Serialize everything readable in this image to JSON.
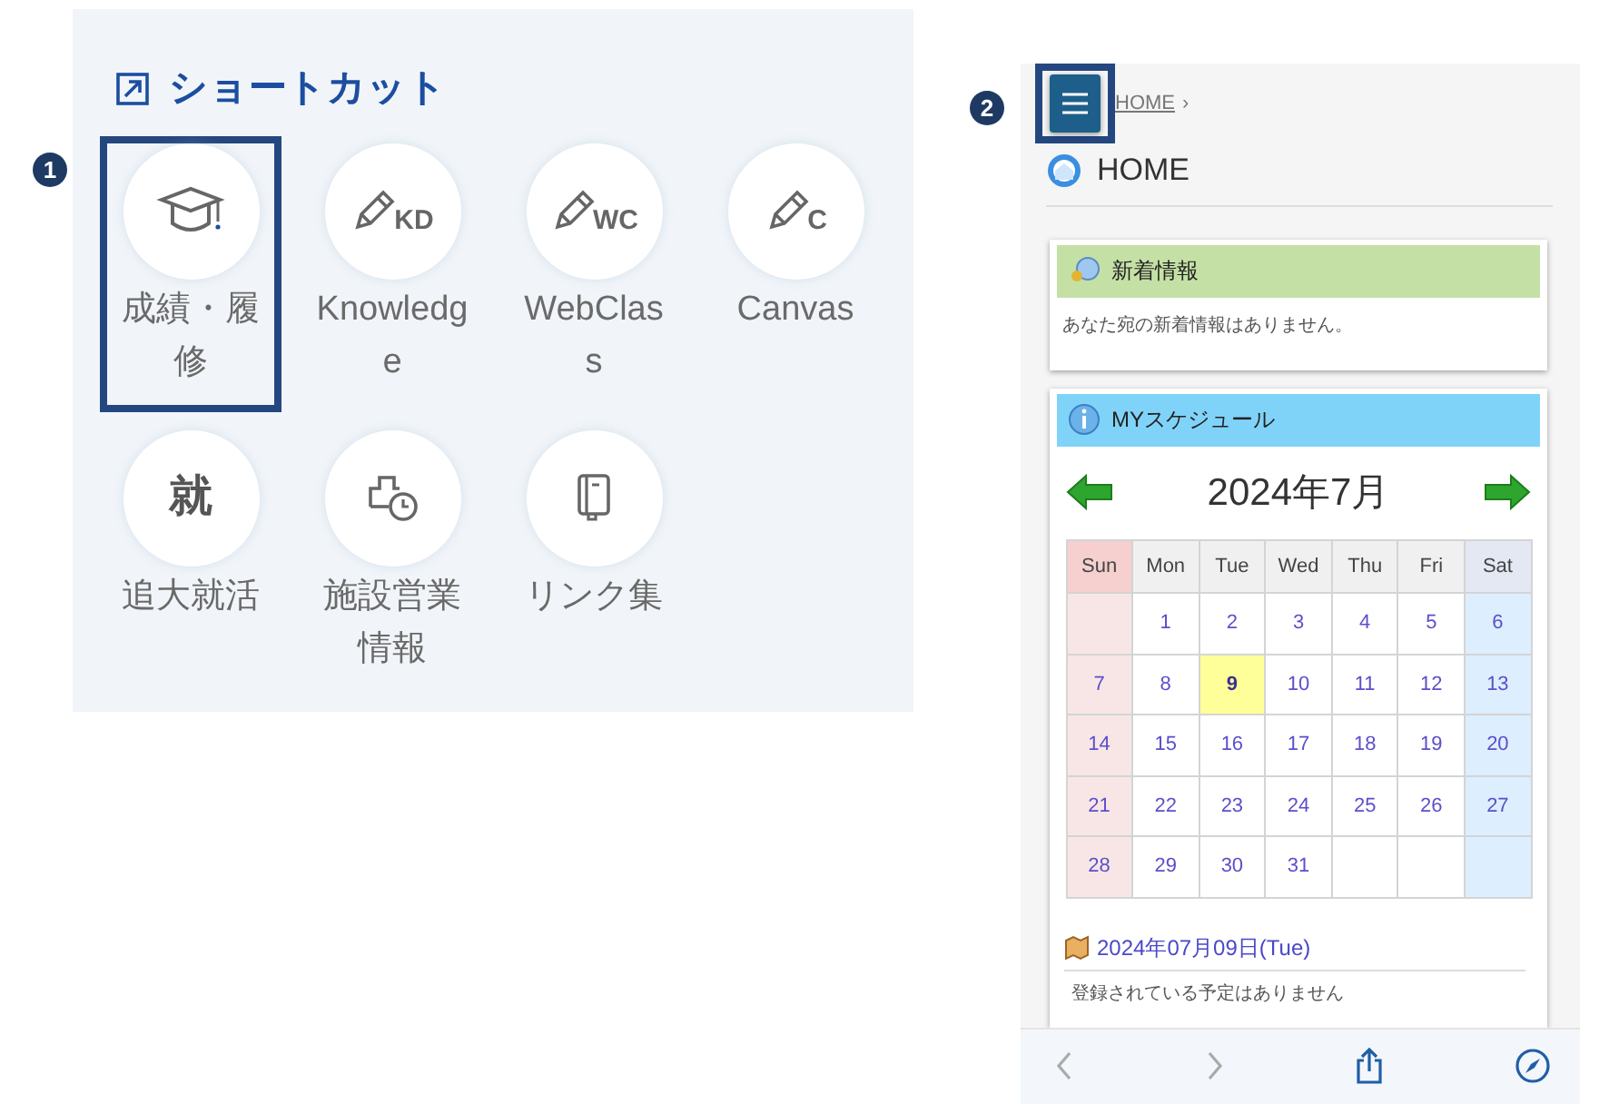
{
  "callouts": [
    {
      "label": "1"
    },
    {
      "label": "2"
    }
  ],
  "shortcut_panel": {
    "title": "ショートカット",
    "items": [
      {
        "label": "成績・履修",
        "kind": "cap",
        "highlighted": true
      },
      {
        "label": "Knowledge",
        "kind": "pencil",
        "icon_text": "KD",
        "highlighted": false
      },
      {
        "label": "WebClass",
        "kind": "pencil",
        "icon_text": "WC",
        "highlighted": false
      },
      {
        "label": "Canvas",
        "kind": "pencil",
        "icon_text": "C",
        "highlighted": false
      },
      {
        "label": "追大就活",
        "kind": "glyph",
        "icon_text": "就",
        "highlighted": false
      },
      {
        "label": "施設営業情報",
        "kind": "building-clock",
        "highlighted": false
      },
      {
        "label": "リンク集",
        "kind": "notebook",
        "highlighted": false
      }
    ]
  },
  "mobile_page": {
    "menu_button": {
      "highlighted": true
    },
    "breadcrumb": {
      "label": "HOME",
      "separator": "›"
    },
    "heading": "HOME",
    "news_card": {
      "title": "新着情報",
      "message": "あなた宛の新着情報はありません。"
    },
    "schedule_card": {
      "title": "MYスケジュール",
      "month": "2024年7月",
      "weekdays": [
        "Sun",
        "Mon",
        "Tue",
        "Wed",
        "Thu",
        "Fri",
        "Sat"
      ],
      "weeks": [
        [
          {
            "kind": "blank"
          },
          {
            "kind": "day",
            "day": "1",
            "selected": false
          },
          {
            "kind": "day",
            "day": "2",
            "selected": false
          },
          {
            "kind": "day",
            "day": "3",
            "selected": false
          },
          {
            "kind": "day",
            "day": "4",
            "selected": false
          },
          {
            "kind": "day",
            "day": "5",
            "selected": false
          },
          {
            "kind": "day",
            "day": "6",
            "selected": false
          }
        ],
        [
          {
            "kind": "day",
            "day": "7",
            "selected": false
          },
          {
            "kind": "day",
            "day": "8",
            "selected": false
          },
          {
            "kind": "day",
            "day": "9",
            "selected": true
          },
          {
            "kind": "day",
            "day": "10",
            "selected": false
          },
          {
            "kind": "day",
            "day": "11",
            "selected": false
          },
          {
            "kind": "day",
            "day": "12",
            "selected": false
          },
          {
            "kind": "day",
            "day": "13",
            "selected": false
          }
        ],
        [
          {
            "kind": "day",
            "day": "14",
            "selected": false
          },
          {
            "kind": "day",
            "day": "15",
            "selected": false
          },
          {
            "kind": "day",
            "day": "16",
            "selected": false
          },
          {
            "kind": "day",
            "day": "17",
            "selected": false
          },
          {
            "kind": "day",
            "day": "18",
            "selected": false
          },
          {
            "kind": "day",
            "day": "19",
            "selected": false
          },
          {
            "kind": "day",
            "day": "20",
            "selected": false
          }
        ],
        [
          {
            "kind": "day",
            "day": "21",
            "selected": false
          },
          {
            "kind": "day",
            "day": "22",
            "selected": false
          },
          {
            "kind": "day",
            "day": "23",
            "selected": false
          },
          {
            "kind": "day",
            "day": "24",
            "selected": false
          },
          {
            "kind": "day",
            "day": "25",
            "selected": false
          },
          {
            "kind": "day",
            "day": "26",
            "selected": false
          },
          {
            "kind": "day",
            "day": "27",
            "selected": false
          }
        ],
        [
          {
            "kind": "day",
            "day": "28",
            "selected": false
          },
          {
            "kind": "day",
            "day": "29",
            "selected": false
          },
          {
            "kind": "day",
            "day": "30",
            "selected": false
          },
          {
            "kind": "day",
            "day": "31",
            "selected": false
          },
          {
            "kind": "blank"
          },
          {
            "kind": "blank"
          },
          {
            "kind": "blank"
          }
        ]
      ],
      "date_link": "2024年07月09日(Tue)",
      "no_events": "登録されている予定はありません"
    },
    "toolbar": [
      {
        "kind": "back",
        "disabled": true
      },
      {
        "kind": "forward",
        "disabled": true
      },
      {
        "kind": "share",
        "disabled": false
      },
      {
        "kind": "compass",
        "disabled": false
      }
    ]
  }
}
